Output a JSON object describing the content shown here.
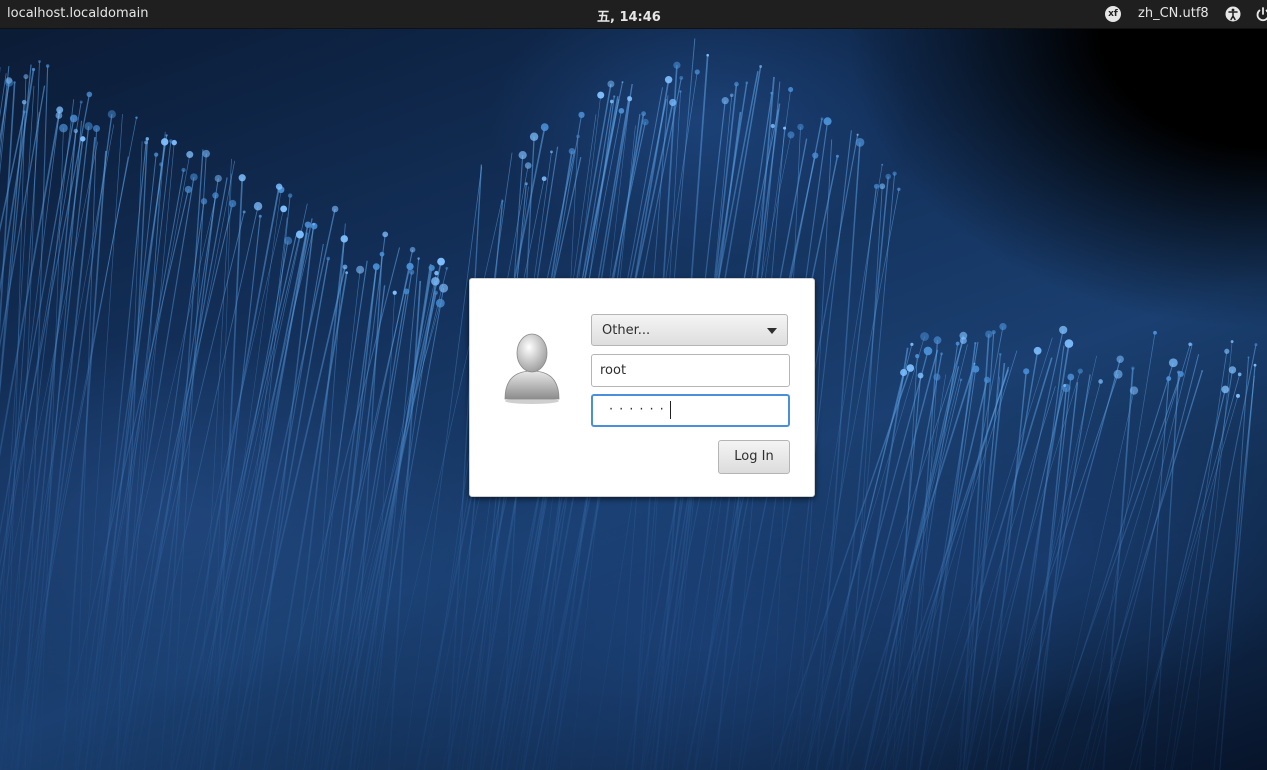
{
  "topbar": {
    "hostname": "localhost.localdomain",
    "clock": "五, 14:46",
    "keyboard_icon_text": "xf",
    "locale": "zh_CN.utf8"
  },
  "icons": {
    "avatar": "user-avatar-icon",
    "keyboard": "keyboard-layout-icon",
    "accessibility": "accessibility-icon",
    "power": "power-icon",
    "dropdown": "chevron-down-icon"
  },
  "login": {
    "user_select_value": "Other...",
    "username_value": "root",
    "password_mask": "······",
    "login_button_label": "Log In"
  },
  "colors": {
    "focus_border": "#4a90d9",
    "topbar_bg": "#1f1f1f"
  }
}
